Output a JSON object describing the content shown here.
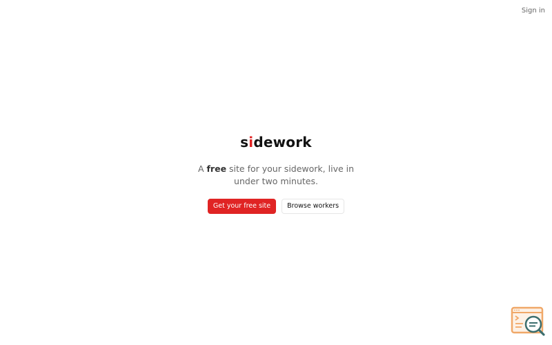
{
  "header": {
    "signin_label": "Sign in"
  },
  "hero": {
    "logo_prefix": "s",
    "logo_accent": "i",
    "logo_suffix": "dework",
    "tagline_before": "A ",
    "tagline_bold": "free",
    "tagline_after": " site for your sidework, live in under two minutes."
  },
  "actions": {
    "primary_label": "Get your free site",
    "secondary_label": "Browse workers"
  },
  "colors": {
    "accent": "#e02424",
    "text": "#111111",
    "muted": "#666666",
    "widget_orange": "#f0a868",
    "widget_teal": "#3b6e6e"
  },
  "widget": {
    "icon": "search-help-widget-icon"
  }
}
